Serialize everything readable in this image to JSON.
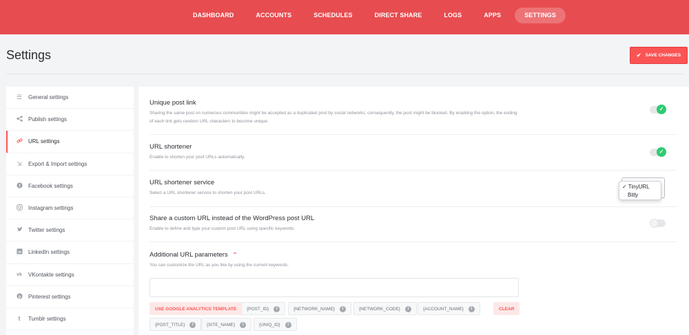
{
  "nav": {
    "items": [
      {
        "label": "DASHBOARD"
      },
      {
        "label": "ACCOUNTS"
      },
      {
        "label": "SCHEDULES"
      },
      {
        "label": "DIRECT SHARE"
      },
      {
        "label": "LOGS"
      },
      {
        "label": "APPS"
      },
      {
        "label": "SETTINGS",
        "active": true
      }
    ]
  },
  "header": {
    "title": "Settings",
    "save_label": "SAVE CHANGES"
  },
  "sidebar": {
    "items": [
      {
        "label": "General settings",
        "icon": "sliders-icon"
      },
      {
        "label": "Publish settings",
        "icon": "share-icon"
      },
      {
        "label": "URL settings",
        "icon": "link-icon",
        "active": true
      },
      {
        "label": "Export & Import settings",
        "icon": "export-icon"
      },
      {
        "label": "Facebook settings",
        "icon": "facebook-icon"
      },
      {
        "label": "Instagram settings",
        "icon": "instagram-icon"
      },
      {
        "label": "Twitter settings",
        "icon": "twitter-icon"
      },
      {
        "label": "LinkedIn settings",
        "icon": "linkedin-icon"
      },
      {
        "label": "VKontakte settings",
        "icon": "vk-icon"
      },
      {
        "label": "Pinterest settings",
        "icon": "pinterest-icon"
      },
      {
        "label": "Tumblr settings",
        "icon": "tumblr-icon"
      }
    ]
  },
  "settings": {
    "unique_link": {
      "title": "Unique post link",
      "desc": "Sharing the same post on numerous communities might be accepted as a duplicated post by social networks; consequently, the post might be blocked. By enabling the option, the ending of each link gets random URL characters to become unique.",
      "enabled": true
    },
    "shortener": {
      "title": "URL shortener",
      "desc": "Enable to shorten your post URLs automatically.",
      "enabled": true
    },
    "shortener_service": {
      "title": "URL shortener service",
      "desc": "Select a URL shortener service to shorten your post URLs.",
      "options": [
        "TinyURL",
        "Bitly"
      ],
      "selected": "TinyURL"
    },
    "custom_url": {
      "title": "Share a custom URL instead of the WordPress post URL",
      "desc": "Enable to define and type your custom post URL using specific keywords.",
      "enabled": false
    },
    "params": {
      "title": "Additional URL parameters",
      "desc": "You can customize the URL as you like by using the current keywords.",
      "input_value": "",
      "ga_button": "USE GOOGLE ANALYTICS TEMPLATE",
      "clear_button": "CLEAR",
      "keywords": [
        "{POST_ID}",
        "{NETWORK_NAME}",
        "{NETWORK_CODE}",
        "{ACCOUNT_NAME}",
        "{POST_TITLE}",
        "{SITE_NAME}",
        "{UNIQ_ID}"
      ]
    }
  },
  "colors": {
    "brand": "#e74c50",
    "accent": "#fb5454",
    "toggle_on": "#2ecc71"
  }
}
